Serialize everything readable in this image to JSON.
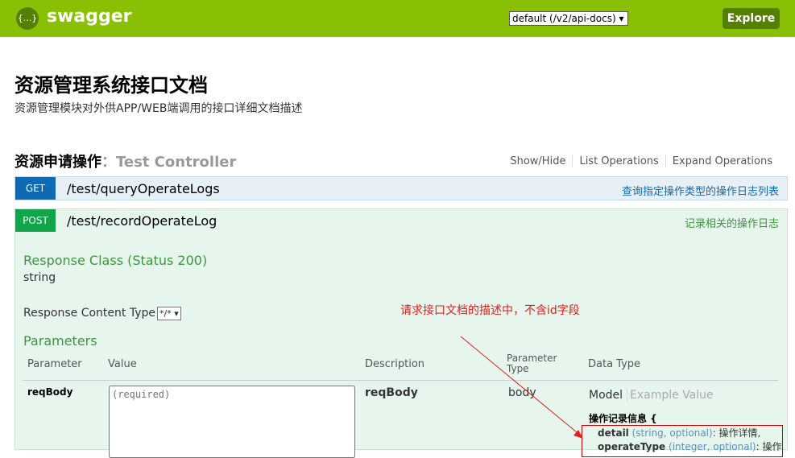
{
  "header": {
    "logo_icon": "{...}",
    "brand": "swagger",
    "spec_select": "default (/v2/api-docs) ▾",
    "explore": "Explore"
  },
  "info": {
    "title": "资源管理系统接口文档",
    "description": "资源管理模块对外供APP/WEB端调用的接口详细文档描述"
  },
  "section": {
    "name": "资源申请操作",
    "controller": "：Test Controller",
    "actions": [
      "Show/Hide",
      "List Operations",
      "Expand Operations"
    ]
  },
  "operations": [
    {
      "method": "GET",
      "path": "/test/queryOperateLogs",
      "summary": "查询指定操作类型的操作日志列表"
    },
    {
      "method": "POST",
      "path": "/test/recordOperateLog",
      "summary": "记录相关的操作日志"
    }
  ],
  "post_detail": {
    "response_class": "Response Class (Status 200)",
    "response_type": "string",
    "content_type_label": "Response Content Type",
    "content_type_value": "*/* ▾",
    "parameters_heading": "Parameters",
    "columns": [
      "Parameter",
      "Value",
      "Description",
      "Parameter Type",
      "Data Type"
    ],
    "param": {
      "name": "reqBody",
      "placeholder": "(required)",
      "description": "reqBody",
      "type": "body"
    },
    "model_tab": "Model",
    "example_tab": "Example Value",
    "model_name": "操作记录信息 {",
    "fields": [
      {
        "name": "detail",
        "meta": "(string, optional)",
        "desc": ": 操作详情,"
      },
      {
        "name": "operateType",
        "meta": "(integer, optional)",
        "desc": ": 操作"
      }
    ]
  },
  "annotation": "请求接口文档的描述中，不含id字段"
}
